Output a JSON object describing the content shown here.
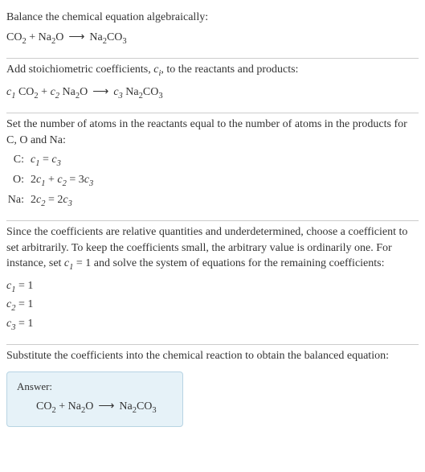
{
  "section1": {
    "text": "Balance the chemical equation algebraically:"
  },
  "section2": {
    "text_part1": "Add stoichiometric coefficients, ",
    "text_part2": ", to the reactants and products:"
  },
  "section3": {
    "text": "Set the number of atoms in the reactants equal to the number of atoms in the products for C, O and Na:",
    "atoms": {
      "c_label": "C:",
      "o_label": "O:",
      "na_label": "Na:"
    }
  },
  "section4": {
    "text_part1": "Since the coefficients are relative quantities and underdetermined, choose a coefficient to set arbitrarily. To keep the coefficients small, the arbitrary value is ordinarily one. For instance, set ",
    "text_part2": " = 1 and solve the system of equations for the remaining coefficients:",
    "c1": " = 1",
    "c2": " = 1",
    "c3": " = 1"
  },
  "section5": {
    "text": "Substitute the coefficients into the chemical reaction to obtain the balanced equation:",
    "answer_label": "Answer:"
  },
  "chem": {
    "CO2_c": "CO",
    "CO2_s": "2",
    "Na2O_n": "Na",
    "Na2O_s": "2",
    "Na2O_o": "O",
    "Na2CO3_n": "Na",
    "Na2CO3_s1": "2",
    "Na2CO3_c": "CO",
    "Na2CO3_s2": "3",
    "plus": " + ",
    "arrow": "⟶"
  },
  "coeff": {
    "c": "c",
    "c1": "1",
    "c2": "2",
    "c3": "3",
    "ci": "i"
  },
  "atom_eqs": {
    "c_c1": "1",
    "c_eq": " = ",
    "c_c3": "3",
    "o_2": "2",
    "o_c1": "1",
    "o_plus": " + ",
    "o_c2": "2",
    "o_eq": " = 3",
    "o_c3": "3",
    "na_2": "2",
    "na_c2": "2",
    "na_eq": " = 2",
    "na_c3": "3"
  }
}
